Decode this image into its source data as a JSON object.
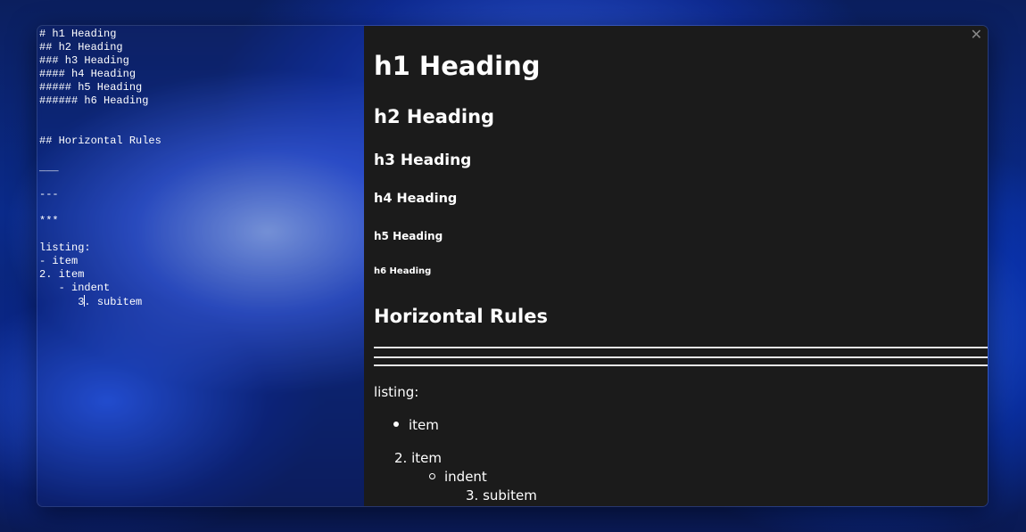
{
  "editor": {
    "lines": [
      "# h1 Heading",
      "## h2 Heading",
      "### h3 Heading",
      "#### h4 Heading",
      "##### h5 Heading",
      "###### h6 Heading",
      "",
      "",
      "## Horizontal Rules",
      "",
      "___",
      "",
      "---",
      "",
      "***",
      "",
      "listing:",
      "- item",
      "2. item",
      "   - indent",
      "      3"
    ],
    "last_line_after_caret": ". subitem"
  },
  "preview": {
    "close_glyph": "✕",
    "h1": "h1 Heading",
    "h2": "h2 Heading",
    "h3": "h3 Heading",
    "h4": "h4 Heading",
    "h5": "h5 Heading",
    "h6": "h6 Heading",
    "section_heading": "Horizontal Rules",
    "listing_label": "listing:",
    "item_bullet": "item",
    "item_numbered": "2. item",
    "indent": "indent",
    "subitem": "3. subitem"
  }
}
